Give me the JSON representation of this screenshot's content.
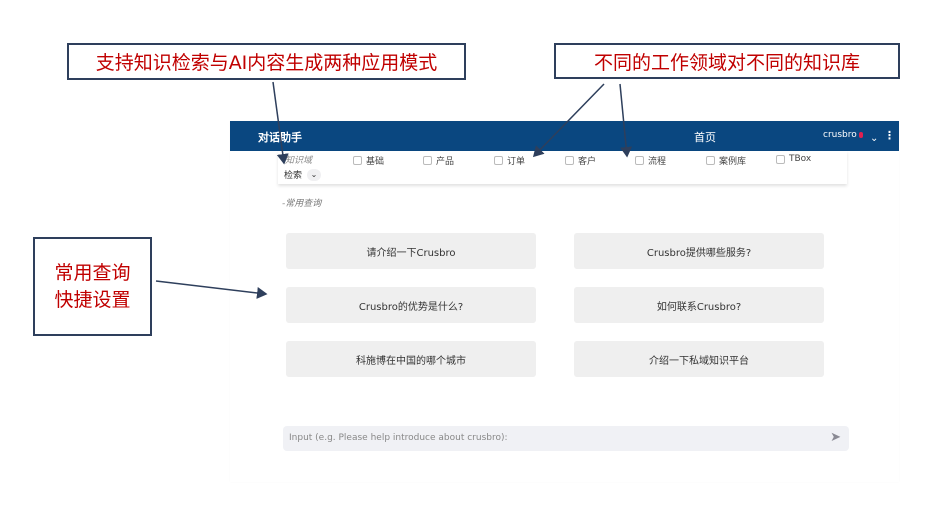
{
  "callouts": {
    "left": "支持知识检索与AI内容生成两种应用模式",
    "right": "不同的工作领域对不同的知识库",
    "bottom_left_line1": "常用查询",
    "bottom_left_line2": "快捷设置"
  },
  "topbar": {
    "title": "对话助手",
    "home": "首页",
    "user": "crusbro",
    "chevron": "⌄",
    "menu": "⋮",
    "bg_color": "#0a4780"
  },
  "filters": {
    "domain_label": "知识域",
    "items": [
      "基础",
      "产品",
      "订单",
      "客户",
      "流程",
      "案例库",
      "TBox"
    ],
    "mode_value": "检索",
    "mode_chevron": "⌄"
  },
  "common_queries": {
    "label": "-常用查询",
    "items": [
      "请介绍一下Crusbro",
      "Crusbro提供哪些服务?",
      "Crusbro的优势是什么?",
      "如何联系Crusbro?",
      "科施博在中国的哪个城市",
      "介绍一下私域知识平台"
    ]
  },
  "chat_input": {
    "placeholder": "Input (e.g. Please help introduce about crusbro):",
    "send_icon": "➤"
  }
}
